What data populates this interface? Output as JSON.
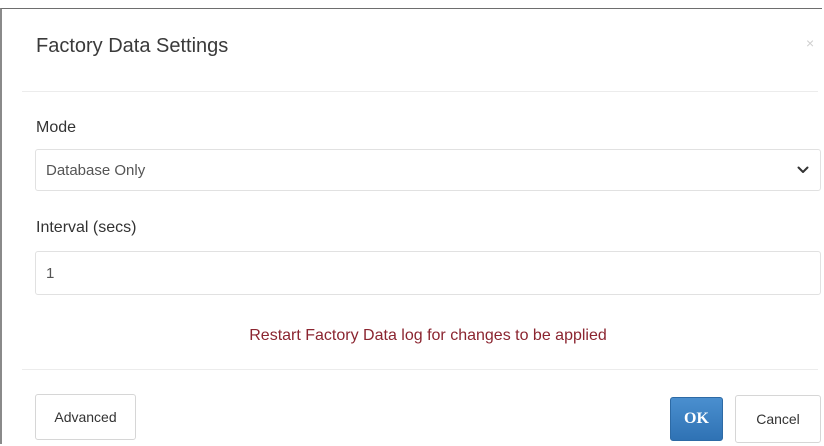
{
  "dialog": {
    "title": "Factory Data Settings",
    "close_glyph": "×"
  },
  "mode": {
    "label": "Mode",
    "selected": "Database Only",
    "icon": "chevron-down-icon"
  },
  "interval": {
    "label": "Interval (secs)",
    "value": "1"
  },
  "notice": {
    "text": "Restart Factory Data log for changes to be applied",
    "color": "#8b2530"
  },
  "footer": {
    "advanced_label": "Advanced",
    "ok_label": "OK",
    "cancel_label": "Cancel",
    "ok_color": "#3a7fc2"
  }
}
